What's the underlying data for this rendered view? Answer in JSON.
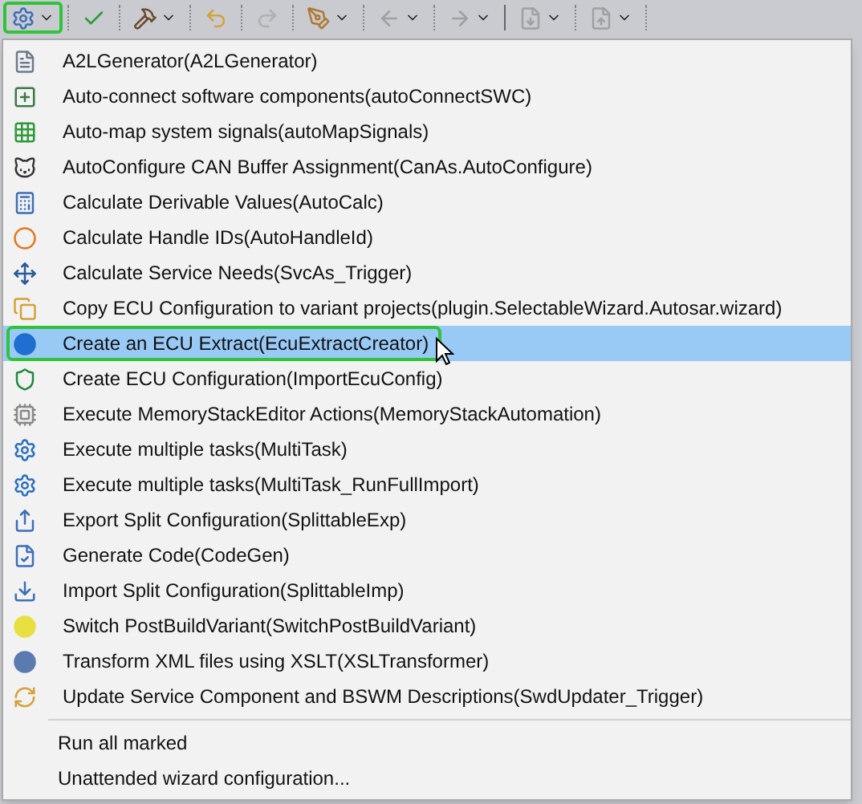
{
  "toolbar": {
    "buttons": [
      {
        "has_dropdown": true,
        "highlighted": true
      },
      {
        "has_dropdown": false,
        "highlighted": false
      },
      {
        "has_dropdown": true,
        "highlighted": false
      },
      {
        "has_dropdown": false,
        "highlighted": false
      },
      {
        "has_dropdown": false,
        "highlighted": false
      },
      {
        "has_dropdown": true,
        "highlighted": false
      },
      {
        "has_dropdown": true,
        "highlighted": false
      },
      {
        "has_dropdown": true,
        "highlighted": false
      },
      {
        "has_dropdown": true,
        "highlighted": false
      },
      {
        "has_dropdown": true,
        "highlighted": false
      }
    ]
  },
  "menu": {
    "items": [
      {
        "label": "A2LGenerator(A2LGenerator)",
        "selected": false
      },
      {
        "label": "Auto-connect software components(autoConnectSWC)",
        "selected": false
      },
      {
        "label": "Auto-map system signals(autoMapSignals)",
        "selected": false
      },
      {
        "label": "AutoConfigure CAN Buffer Assignment(CanAs.AutoConfigure)",
        "selected": false
      },
      {
        "label": "Calculate Derivable Values(AutoCalc)",
        "selected": false
      },
      {
        "label": "Calculate Handle IDs(AutoHandleId)",
        "selected": false
      },
      {
        "label": "Calculate Service Needs(SvcAs_Trigger)",
        "selected": false
      },
      {
        "label": "Copy ECU Configuration to variant projects(plugin.SelectableWizard.Autosar.wizard)",
        "selected": false
      },
      {
        "label": "Create an ECU Extract(EcuExtractCreator)",
        "selected": true
      },
      {
        "label": "Create ECU Configuration(ImportEcuConfig)",
        "selected": false
      },
      {
        "label": "Execute MemoryStackEditor Actions(MemoryStackAutomation)",
        "selected": false
      },
      {
        "label": "Execute multiple tasks(MultiTask)",
        "selected": false
      },
      {
        "label": "Execute multiple tasks(MultiTask_RunFullImport)",
        "selected": false
      },
      {
        "label": "Export Split Configuration(SplittableExp)",
        "selected": false
      },
      {
        "label": "Generate Code(CodeGen)",
        "selected": false
      },
      {
        "label": "Import Split Configuration(SplittableImp)",
        "selected": false
      },
      {
        "label": "Switch PostBuildVariant(SwitchPostBuildVariant)",
        "selected": false
      },
      {
        "label": "Transform XML files using XSLT(XSLTransformer)",
        "selected": false
      },
      {
        "label": "Update Service Component and BSWM Descriptions(SwdUpdater_Trigger)",
        "selected": false
      }
    ],
    "extra_items": [
      {
        "label": "Run all marked"
      },
      {
        "label": "Unattended wizard configuration..."
      }
    ]
  }
}
